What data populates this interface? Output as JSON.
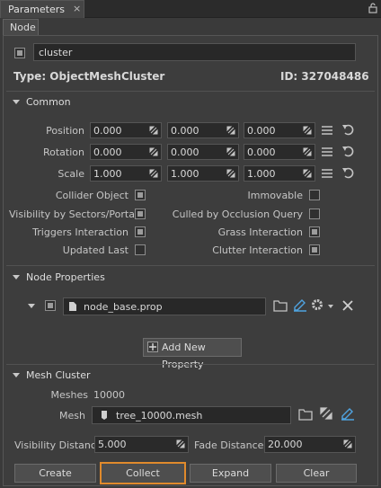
{
  "window": {
    "tab_label": "Parameters",
    "close_glyph": "×"
  },
  "node_tab": "Node",
  "node_name": "cluster",
  "type_line": "Type: ObjectMeshCluster",
  "id_line": "ID: 327048486",
  "common": {
    "header": "Common",
    "position_label": "Position",
    "rotation_label": "Rotation",
    "scale_label": "Scale",
    "position": [
      "0.000",
      "0.000",
      "0.000"
    ],
    "rotation": [
      "0.000",
      "0.000",
      "0.000"
    ],
    "scale": [
      "1.000",
      "1.000",
      "1.000"
    ],
    "flags_left": [
      {
        "label": "Collider Object",
        "checked": true
      },
      {
        "label": "Visibility by Sectors/Portals",
        "checked": true
      },
      {
        "label": "Triggers Interaction",
        "checked": true
      },
      {
        "label": "Updated Last",
        "checked": false
      }
    ],
    "flags_right": [
      {
        "label": "Immovable",
        "checked": false
      },
      {
        "label": "Culled by Occlusion Query",
        "checked": false
      },
      {
        "label": "Grass Interaction",
        "checked": true
      },
      {
        "label": "Clutter Interaction",
        "checked": true
      }
    ]
  },
  "node_properties": {
    "header": "Node Properties",
    "property_file": "node_base.prop",
    "add_button": "Add New Property"
  },
  "mesh_cluster": {
    "header": "Mesh Cluster",
    "meshes_label": "Meshes",
    "meshes_value": "10000",
    "mesh_label": "Mesh",
    "mesh_file": "tree_10000.mesh",
    "visibility_label": "Visibility Distance",
    "visibility_value": "5.000",
    "fade_label": "Fade Distance",
    "fade_value": "20.000"
  },
  "buttons": {
    "create": "Create",
    "collect": "Collect",
    "expand": "Expand",
    "clear": "Clear"
  },
  "colors": {
    "selected_outline": "#e08a2c",
    "panel": "#3d3d3d",
    "field": "#2a2a2a"
  }
}
